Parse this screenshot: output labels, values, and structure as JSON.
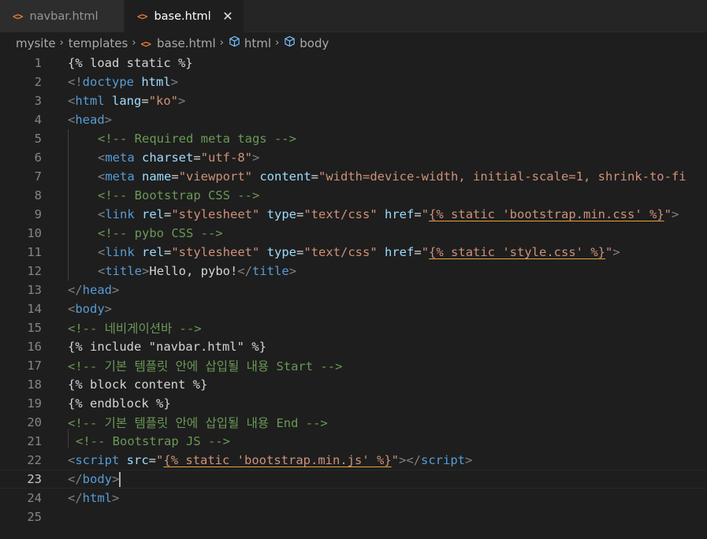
{
  "tabs": [
    {
      "icon": "<>",
      "label": "navbar.html",
      "active": false
    },
    {
      "icon": "<>",
      "label": "base.html",
      "active": true,
      "close": "✕"
    }
  ],
  "breadcrumb": {
    "items": [
      "mysite",
      "templates",
      "base.html",
      "html",
      "body"
    ],
    "separator": "›"
  },
  "editor": {
    "current_line": 23,
    "line_numbers": [
      "1",
      "2",
      "3",
      "4",
      "5",
      "6",
      "7",
      "8",
      "9",
      "10",
      "11",
      "12",
      "13",
      "14",
      "15",
      "16",
      "17",
      "18",
      "19",
      "20",
      "21",
      "22",
      "23",
      "24",
      "25"
    ]
  },
  "code": {
    "l1": "{% load static %}",
    "l2": {
      "open": "<!",
      "tag": "doctype",
      "attr": " html",
      "close": ">"
    },
    "l3": {
      "open": "<",
      "tag": "html",
      "attr": " lang",
      "eq": "=",
      "val": "\"ko\"",
      "close": ">"
    },
    "l4": {
      "open": "<",
      "tag": "head",
      "close": ">"
    },
    "l5": "<!-- Required meta tags -->",
    "l6": {
      "open": "<",
      "tag": "meta",
      "attr": " charset",
      "eq": "=",
      "val": "\"utf-8\"",
      "close": ">"
    },
    "l7": {
      "open": "<",
      "tag": "meta",
      "attr1": " name",
      "eq": "=",
      "val1": "\"viewport\"",
      "attr2": " content",
      "val2": "\"width=device-width, initial-scale=1, shrink-to-fi"
    },
    "l8": "<!-- Bootstrap CSS -->",
    "l9": {
      "open": "<",
      "tag": "link",
      "attr1": " rel",
      "eq": "=",
      "val1": "\"stylesheet\"",
      "attr2": " type",
      "val2": "\"text/css\"",
      "attr3": " href",
      "q": "\"",
      "tpl": "{% static 'bootstrap.min.css' %}",
      "close": ">"
    },
    "l10": "<!-- pybo CSS -->",
    "l11": {
      "open": "<",
      "tag": "link",
      "attr1": " rel",
      "eq": "=",
      "val1": "\"stylesheet\"",
      "attr2": " type",
      "val2": "\"text/css\"",
      "attr3": " href",
      "q": "\"",
      "tpl": "{% static 'style.css' %}",
      "close": ">"
    },
    "l12": {
      "open": "<",
      "tag": "title",
      "close": ">",
      "text": "Hello, pybo!",
      "open2": "</",
      "tag2": "title"
    },
    "l13": {
      "open": "</",
      "tag": "head",
      "close": ">"
    },
    "l14": {
      "open": "<",
      "tag": "body",
      "close": ">"
    },
    "l15": "<!-- 네비게이션바 -->",
    "l16": "{% include \"navbar.html\" %}",
    "l17": "<!-- 기본 템플릿 안에 삽입될 내용 Start -->",
    "l18": "{% block content %}",
    "l19": "{% endblock %}",
    "l20": "<!-- 기본 템플릿 안에 삽입될 내용 End -->",
    "l21": "<!-- Bootstrap JS -->",
    "l22": {
      "open": "<",
      "tag": "script",
      "attr": " src",
      "eq": "=",
      "q": "\"",
      "tpl": "{% static 'bootstrap.min.js' %}",
      "close": ">",
      "open2": "</",
      "tag2": "script"
    },
    "l23": {
      "open": "</",
      "tag": "body",
      "close": ">"
    },
    "l24": {
      "open": "</",
      "tag": "html",
      "close": ">"
    },
    "l25": ""
  },
  "colors": {
    "tag": "#569cd6",
    "attribute": "#9cdcfe",
    "string": "#ce9178",
    "comment": "#6a9955",
    "bracket": "#808080",
    "html_icon": "#e37933",
    "symbol_icon": "#75beff"
  },
  "icons": {
    "file": "html-file-icon",
    "symbol": "element-cube-icon",
    "close": "close-icon",
    "chevron": "chevron-right-icon"
  }
}
